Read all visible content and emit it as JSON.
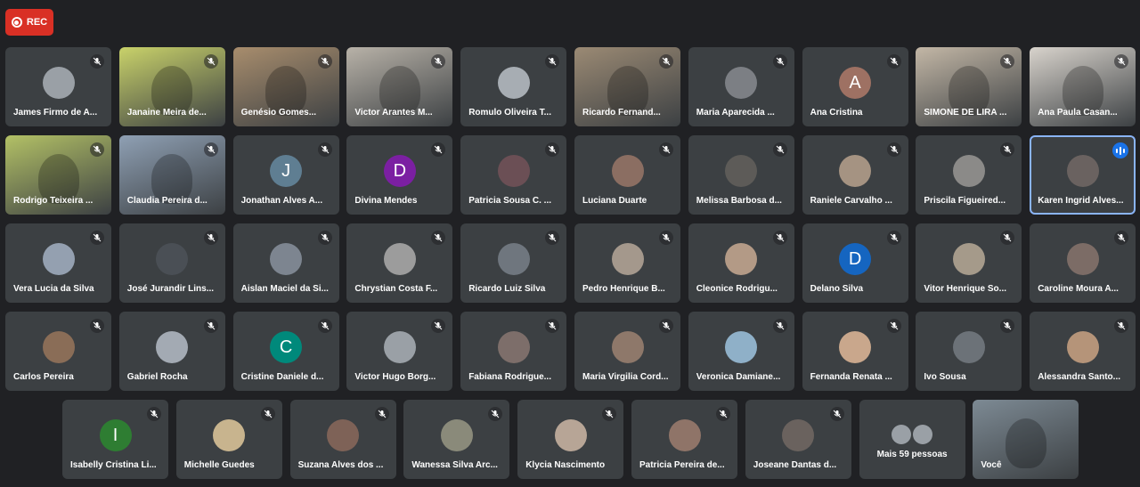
{
  "rec_label": "REC",
  "rows": [
    [
      {
        "name": "James Firmo de A...",
        "type": "avatar",
        "bg": "#9aa0a6"
      },
      {
        "name": "Janaine Meira de...",
        "type": "video",
        "bg": "#c9d26a"
      },
      {
        "name": "Genésio Gomes...",
        "type": "video",
        "bg": "#a88d6d"
      },
      {
        "name": "Victor Arantes M...",
        "type": "video",
        "bg": "#b8b2a8"
      },
      {
        "name": "Romulo Oliveira T...",
        "type": "avatar",
        "bg": "#a7adb3"
      },
      {
        "name": "Ricardo Fernand...",
        "type": "video",
        "bg": "#9b8a74"
      },
      {
        "name": "Maria Aparecida ...",
        "type": "avatar",
        "bg": "#7c7f84"
      },
      {
        "name": "Ana Cristina",
        "type": "letter",
        "letter": "A",
        "bg": "#9e7163"
      },
      {
        "name": "SIMONE DE LIRA ...",
        "type": "video",
        "bg": "#c3b7a6"
      },
      {
        "name": "Ana Paula Casan...",
        "type": "video",
        "bg": "#d8d3cc"
      }
    ],
    [
      {
        "name": "Rodrigo Teixeira ...",
        "type": "video",
        "bg": "#b3c166"
      },
      {
        "name": "Claudia Pereira d...",
        "type": "video",
        "bg": "#8fa0b4"
      },
      {
        "name": "Jonathan Alves A...",
        "type": "letter",
        "letter": "J",
        "bg": "#5f7e92"
      },
      {
        "name": "Divina Mendes",
        "type": "letter",
        "letter": "D",
        "bg": "#7b1fa2"
      },
      {
        "name": "Patricia Sousa C. ...",
        "type": "avatar",
        "bg": "#6b4f55"
      },
      {
        "name": "Luciana Duarte",
        "type": "avatar",
        "bg": "#8b6e62"
      },
      {
        "name": "Melissa Barbosa d...",
        "type": "avatar",
        "bg": "#5d5b58"
      },
      {
        "name": "Raniele Carvalho ...",
        "type": "avatar",
        "bg": "#a59382"
      },
      {
        "name": "Priscila Figueired...",
        "type": "avatar",
        "bg": "#8b8a88"
      },
      {
        "name": "Karen Ingrid Alves...",
        "type": "avatar",
        "bg": "#6a6260",
        "speaking": true
      }
    ],
    [
      {
        "name": "Vera Lucia da Silva",
        "type": "avatar",
        "bg": "#94a0b0"
      },
      {
        "name": "José Jurandir Lins...",
        "type": "avatar",
        "bg": "#4a4f55"
      },
      {
        "name": "Aislan Maciel da Si...",
        "type": "avatar",
        "bg": "#7d8590"
      },
      {
        "name": "Chrystian Costa F...",
        "type": "avatar",
        "bg": "#9c9c9c"
      },
      {
        "name": "Ricardo Luiz Silva",
        "type": "avatar",
        "bg": "#6f767e"
      },
      {
        "name": "Pedro Henrique B...",
        "type": "avatar",
        "bg": "#a4988c"
      },
      {
        "name": "Cleonice Rodrigu...",
        "type": "avatar",
        "bg": "#b39a86"
      },
      {
        "name": "Delano Silva",
        "type": "letter",
        "letter": "D",
        "bg": "#1565c0"
      },
      {
        "name": "Vitor Henrique So...",
        "type": "avatar",
        "bg": "#a59a8a"
      },
      {
        "name": "Caroline Moura A...",
        "type": "avatar",
        "bg": "#7c6c66"
      }
    ],
    [
      {
        "name": "Carlos Pereira",
        "type": "avatar",
        "bg": "#8a6d57"
      },
      {
        "name": "Gabriel Rocha",
        "type": "avatar",
        "bg": "#a3aab3"
      },
      {
        "name": "Cristine Daniele d...",
        "type": "letter",
        "letter": "C",
        "bg": "#00897b"
      },
      {
        "name": "Victor Hugo Borg...",
        "type": "avatar",
        "bg": "#9aa0a6"
      },
      {
        "name": "Fabiana Rodrigue...",
        "type": "avatar",
        "bg": "#7d6e6a"
      },
      {
        "name": "Maria Virgilia Cord...",
        "type": "avatar",
        "bg": "#8e786a"
      },
      {
        "name": "Veronica Damiane...",
        "type": "avatar",
        "bg": "#8fb0c8"
      },
      {
        "name": "Fernanda Renata ...",
        "type": "avatar",
        "bg": "#c9a78c"
      },
      {
        "name": "Ivo Sousa",
        "type": "avatar",
        "bg": "#6c7278"
      },
      {
        "name": "Alessandra Santo...",
        "type": "avatar",
        "bg": "#b59479"
      }
    ],
    [
      {
        "name": "Isabelly Cristina Li...",
        "type": "letter",
        "letter": "I",
        "bg": "#2e7d32"
      },
      {
        "name": "Michelle Guedes",
        "type": "avatar",
        "bg": "#c8b48e"
      },
      {
        "name": "Suzana Alves dos ...",
        "type": "avatar",
        "bg": "#7e6257"
      },
      {
        "name": "Wanessa Silva Arc...",
        "type": "avatar",
        "bg": "#8a8a7a"
      },
      {
        "name": "Klycia Nascimento",
        "type": "avatar",
        "bg": "#b7a596"
      },
      {
        "name": "Patricia Pereira de...",
        "type": "avatar",
        "bg": "#8f7468"
      },
      {
        "name": "Joseane Dantas d...",
        "type": "avatar",
        "bg": "#6a625e"
      },
      {
        "name": "Mais 59 pessoas",
        "type": "more"
      },
      {
        "name": "Você",
        "type": "video",
        "bg": "#7d8a94"
      }
    ]
  ]
}
